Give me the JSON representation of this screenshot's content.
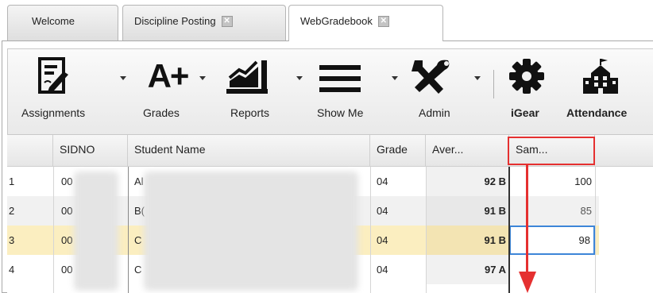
{
  "tabs": [
    {
      "label": "Welcome",
      "closable": false
    },
    {
      "label": "Discipline Posting",
      "closable": true
    },
    {
      "label": "WebGradebook",
      "closable": true,
      "active": true
    }
  ],
  "toolbar": {
    "assignments": "Assignments",
    "grades": "Grades",
    "reports": "Reports",
    "show_me": "Show Me",
    "admin": "Admin",
    "igear": "iGear",
    "attendance": "Attendance",
    "grades_icon_text": "A+"
  },
  "grid": {
    "headers": {
      "rownum": "",
      "sidno": "SIDNO",
      "name": "Student Name",
      "grade": "Grade",
      "average": "Aver...",
      "assignment": "Sam..."
    },
    "rows": [
      {
        "num": "1",
        "sidno": "00",
        "name": "Al",
        "grade": "04",
        "avg": "92 B",
        "score": "100"
      },
      {
        "num": "2",
        "sidno": "00",
        "name": "B(",
        "grade": "04",
        "avg": "91 B",
        "score": "85"
      },
      {
        "num": "3",
        "sidno": "00",
        "name": "C",
        "grade": "04",
        "avg": "91 B",
        "score": "98"
      },
      {
        "num": "4",
        "sidno": "00",
        "name": "C",
        "grade": "04",
        "avg": "97 A",
        "score": ""
      }
    ]
  },
  "colors": {
    "highlight": "#e53030",
    "selected_row": "#fbeec0",
    "average_bg": "#f1f1f1",
    "active_input_border": "#3d86d8"
  }
}
